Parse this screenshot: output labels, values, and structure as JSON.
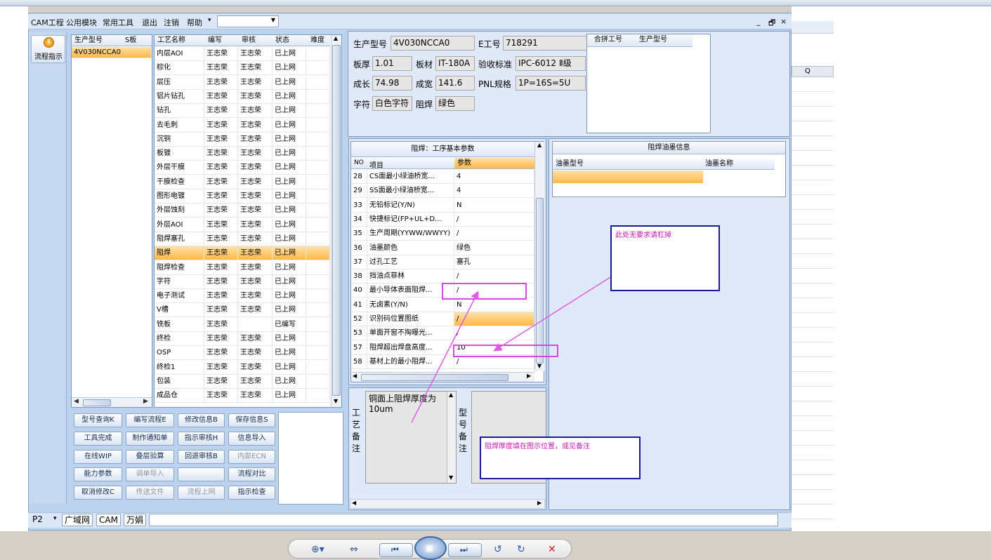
{
  "menubar": {
    "items": [
      "CAM工程",
      "公用模块",
      "常用工具",
      "退出",
      "注销",
      "帮助"
    ],
    "window_controls": [
      "_",
      "🗗",
      "×"
    ]
  },
  "left_nav": {
    "button_label": "流程指示"
  },
  "model_grid": {
    "headers": [
      "生产型号",
      "S板"
    ],
    "rows": [
      [
        "4V030NCCA0",
        ""
      ]
    ]
  },
  "process_grid": {
    "headers": [
      "工艺名称",
      "编写",
      "审核",
      "状态",
      "难度"
    ],
    "selected_index": 15,
    "rows": [
      [
        "内层AOI",
        "王志荣",
        "王志荣",
        "已上网",
        ""
      ],
      [
        "棕化",
        "王志荣",
        "王志荣",
        "已上网",
        ""
      ],
      [
        "层压",
        "王志荣",
        "王志荣",
        "已上网",
        ""
      ],
      [
        "铝片钻孔",
        "王志荣",
        "王志荣",
        "已上网",
        ""
      ],
      [
        "钻孔",
        "王志荣",
        "王志荣",
        "已上网",
        ""
      ],
      [
        "去毛刺",
        "王志荣",
        "王志荣",
        "已上网",
        ""
      ],
      [
        "沉铜",
        "王志荣",
        "王志荣",
        "已上网",
        ""
      ],
      [
        "板镀",
        "王志荣",
        "王志荣",
        "已上网",
        ""
      ],
      [
        "外层干膜",
        "王志荣",
        "王志荣",
        "已上网",
        ""
      ],
      [
        "干膜检查",
        "王志荣",
        "王志荣",
        "已上网",
        ""
      ],
      [
        "图形电镀",
        "王志荣",
        "王志荣",
        "已上网",
        ""
      ],
      [
        "外层蚀刻",
        "王志荣",
        "王志荣",
        "已上网",
        ""
      ],
      [
        "外层AOI",
        "王志荣",
        "王志荣",
        "已上网",
        ""
      ],
      [
        "阻焊塞孔",
        "王志荣",
        "王志荣",
        "已上网",
        ""
      ],
      [
        "阻焊",
        "王志荣",
        "王志荣",
        "已上网",
        ""
      ],
      [
        "阻焊检查",
        "王志荣",
        "王志荣",
        "已上网",
        ""
      ],
      [
        "字符",
        "王志荣",
        "王志荣",
        "已上网",
        ""
      ],
      [
        "电子测试",
        "王志荣",
        "王志荣",
        "已上网",
        ""
      ],
      [
        "V槽",
        "王志荣",
        "王志荣",
        "已上网",
        ""
      ],
      [
        "铣板",
        "王志荣",
        "",
        "已编写",
        ""
      ],
      [
        "终检",
        "王志荣",
        "王志荣",
        "已上网",
        ""
      ],
      [
        "OSP",
        "王志荣",
        "王志荣",
        "已上网",
        ""
      ],
      [
        "终检1",
        "王志荣",
        "王志荣",
        "已上网",
        ""
      ],
      [
        "包装",
        "王志荣",
        "王志荣",
        "已上网",
        ""
      ],
      [
        "成品仓",
        "王志荣",
        "王志荣",
        "已上网",
        ""
      ]
    ]
  },
  "buttons": [
    [
      "型号查询K",
      "编写流程E",
      "修改信息B",
      "保存信息S"
    ],
    [
      "工具完成",
      "制作通知单",
      "指示审核H",
      "信息导入"
    ],
    [
      "在线WIP",
      "叠层验算",
      "回退审核B",
      "内部ECN"
    ],
    [
      "能力参数",
      "调单导入",
      "",
      "流程对比"
    ],
    [
      "取消修改C",
      "传送文件",
      "流程上网",
      "指示检查"
    ]
  ],
  "info": {
    "model_label": "生产型号",
    "model_value": "4V030NCCA0",
    "eno_label": "E工号",
    "eno_value": "718291",
    "thickness_label": "板厚",
    "thickness_value": "1.01",
    "material_label": "板材",
    "material_value": "IT-180A",
    "standard_label": "验收标准",
    "standard_value": "IPC-6012 Ⅱ级",
    "length_label": "成长",
    "length_value": "74.98",
    "width_label": "成宽",
    "width_value": "141.6",
    "pnl_label": "PNL规格",
    "pnl_value": "1P=16S=5U",
    "char_label": "字符",
    "char_value": "白色字符",
    "mask_label": "阻焊",
    "mask_value": "绿色"
  },
  "merge_grid": {
    "headers": [
      "合拼工号",
      "生产型号"
    ]
  },
  "params": {
    "title": "阻焊：工序基本参数",
    "headers": [
      "NO",
      "项目",
      "参数"
    ],
    "rows": [
      [
        "28",
        "CS面最小绿油桥宽...",
        "4"
      ],
      [
        "29",
        "SS面最小绿油桥宽...",
        "4"
      ],
      [
        "33",
        "无铅标记(Y/N)",
        "N"
      ],
      [
        "34",
        "快捷标记(FP+UL+D...",
        "/"
      ],
      [
        "35",
        "生产周期(YYWW/WWYY)",
        "/"
      ],
      [
        "36",
        "油墨颜色",
        "绿色"
      ],
      [
        "37",
        "过孔工艺",
        "塞孔"
      ],
      [
        "38",
        "挡油点菲林",
        "/"
      ],
      [
        "40",
        "最小导体表面阻焊...",
        "/"
      ],
      [
        "41",
        "无卤素(Y/N)",
        "N"
      ],
      [
        "52",
        "识别码位置图纸",
        "/"
      ],
      [
        "53",
        "单面开窗不掏曝光...",
        "/"
      ],
      [
        "57",
        "阻焊超出焊盘高度...",
        "10"
      ],
      [
        "58",
        "基材上的最小阻焊...",
        "/"
      ]
    ]
  },
  "ink": {
    "title": "阻焊油墨信息",
    "headers": [
      "油墨型号",
      "油墨名称"
    ]
  },
  "remarks": {
    "process_label": "工艺备注",
    "process_text": "铜面上阻焊厚度为10um",
    "model_label": "型号备注"
  },
  "annotations": {
    "note1": "此处无要求请杠掉",
    "note2": "阻焊厚度填在图示位置，或见备注"
  },
  "bottom_tabs": {
    "page": "P2",
    "tabs": [
      "广域网",
      "CAM",
      "万娟"
    ]
  },
  "excel": {
    "column": "Q"
  }
}
